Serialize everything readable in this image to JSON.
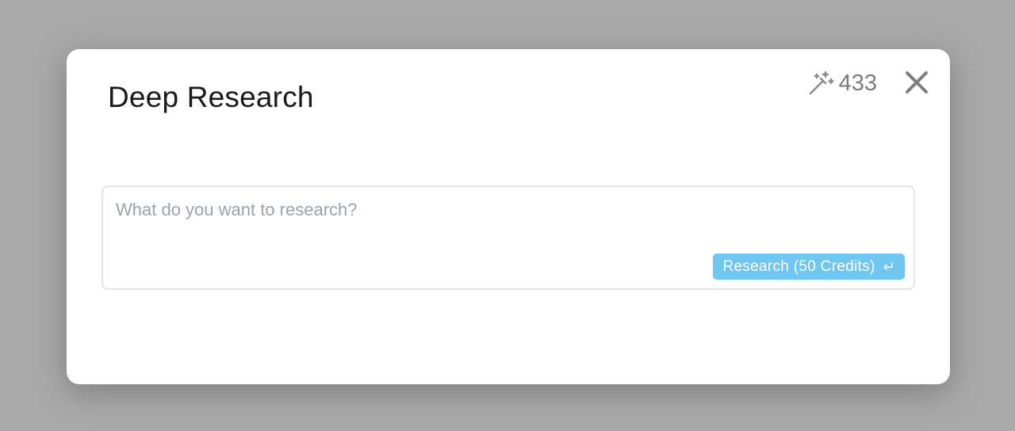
{
  "modal": {
    "title": "Deep Research",
    "credits": {
      "icon": "magic-wand-icon",
      "value": "433"
    },
    "close_icon": "close-icon"
  },
  "research": {
    "placeholder": "What do you want to research?",
    "value": "",
    "button_label": "Research (50 Credits)",
    "button_icon": "enter-icon",
    "button_color": "#6ec6f1"
  }
}
